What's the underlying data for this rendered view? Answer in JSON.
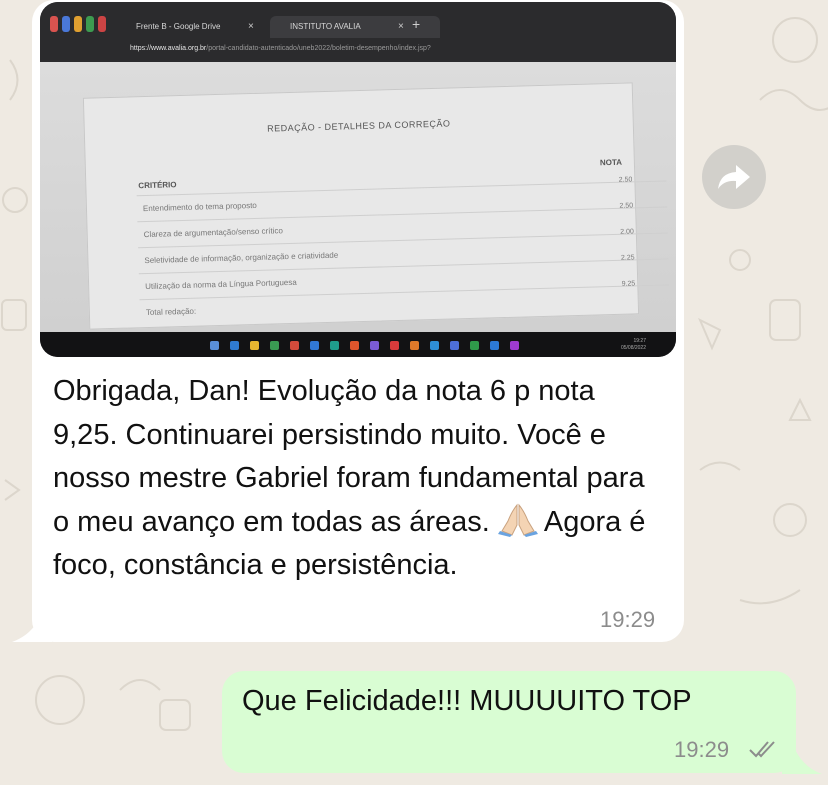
{
  "screenshot_photo": {
    "tabs": [
      {
        "label": "Frente B - Google Drive",
        "close": "×"
      },
      {
        "label": "INSTITUTO AVALIA",
        "close": "×"
      }
    ],
    "new_tab": "+",
    "url": {
      "domain": "https://www.avalia.org.br",
      "path": "/portal-candidato-autenticado/uneb2022/boletim-desempenho/index.jsp?"
    },
    "card_title": "REDAÇÃO - DETALHES DA CORREÇÃO",
    "table": {
      "criterio_header": "CRITÉRIO",
      "nota_header": "NOTA",
      "rows": [
        {
          "label": "Entendimento do tema proposto",
          "nota": "2.50"
        },
        {
          "label": "Clareza de argumentação/senso crítico",
          "nota": "2.50"
        },
        {
          "label": "Seletividade de informação, organização e criatividade",
          "nota": "2.00"
        },
        {
          "label": "Utilização da norma da Língua Portuguesa",
          "nota": "2.25"
        },
        {
          "label": "Total redação:",
          "nota": "9.25"
        }
      ]
    },
    "clock": {
      "time": "19:27",
      "date": "05/08/2022"
    }
  },
  "incoming_message": {
    "text_before_emoji": "Obrigada, Dan! Evolução da nota 6 p nota 9,25. Continuarei persistindo muito. Você e nosso mestre Gabriel foram fundamental para o meu avanço em todas as áreas.",
    "emoji": "folded-hands",
    "text_after_emoji": "Agora é foco, constância e persistência.",
    "time": "19:29"
  },
  "outgoing_message": {
    "text": "Que Felicidade!!! MUUUUITO TOP",
    "time": "19:29",
    "status": "read"
  },
  "colors": {
    "chat_background": "#efeae2",
    "incoming_bubble": "#ffffff",
    "outgoing_bubble": "#d9fdd3",
    "timestamp": "#8c8c8c",
    "forward_button": "#d2d0cb"
  },
  "icons": [
    "forward-icon",
    "double-check-icon",
    "folded-hands-emoji"
  ]
}
